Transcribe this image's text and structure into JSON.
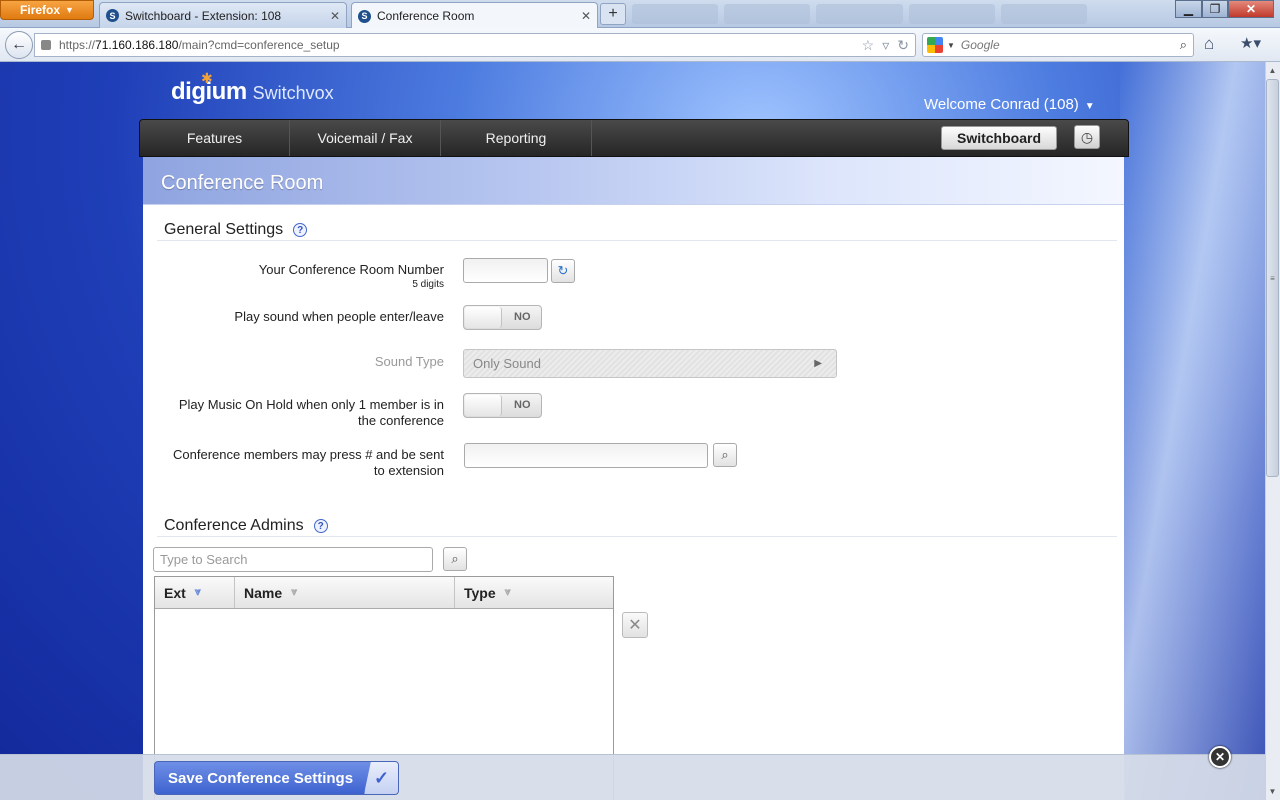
{
  "browser": {
    "app_button": "Firefox",
    "tabs": [
      {
        "label": "Switchboard - Extension: 108"
      },
      {
        "label": "Conference Room"
      }
    ],
    "new_tab": "+",
    "url_prefix": "https://",
    "url_host": "71.160.186.180",
    "url_path": "/main?cmd=conference_setup",
    "search_placeholder": "Google"
  },
  "header": {
    "brand_primary": "digium",
    "brand_secondary": "Switchvox",
    "welcome": "Welcome Conrad (108)"
  },
  "nav": {
    "items": [
      "Features",
      "Voicemail / Fax",
      "Reporting"
    ],
    "switchboard": "Switchboard"
  },
  "page": {
    "title": "Conference Room"
  },
  "general_settings": {
    "title": "General Settings",
    "room_number_label": "Your Conference Room Number",
    "room_number_hint": "5 digits",
    "room_number_value": "",
    "play_sound_label": "Play sound when people enter/leave",
    "play_sound_value": "NO",
    "sound_type_label": "Sound Type",
    "sound_type_value": "Only Sound",
    "moh_label_line1": "Play Music On Hold when only 1 member is in",
    "moh_label_line2": "the conference",
    "moh_value": "NO",
    "press_hash_label_line1": "Conference members may press # and be sent",
    "press_hash_label_line2": "to extension",
    "press_hash_value": ""
  },
  "admins": {
    "title": "Conference Admins",
    "search_placeholder": "Type to Search",
    "columns": [
      "Ext",
      "Name",
      "Type"
    ],
    "rows": []
  },
  "footer": {
    "save_label": "Save Conference Settings"
  }
}
